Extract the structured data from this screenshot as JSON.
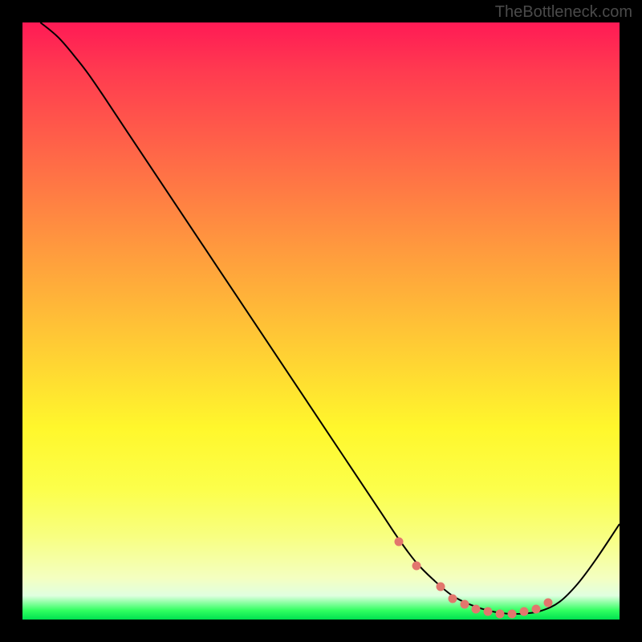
{
  "watermark": "TheBottleneck.com",
  "chart_data": {
    "type": "line",
    "title": "",
    "xlabel": "",
    "ylabel": "",
    "xlim": [
      0,
      100
    ],
    "ylim": [
      0,
      100
    ],
    "series": [
      {
        "name": "curve",
        "x": [
          3,
          6,
          9,
          12,
          18,
          24,
          30,
          36,
          42,
          48,
          54,
          60,
          63,
          66,
          69,
          72,
          75,
          78,
          81,
          84,
          87,
          90,
          93,
          96,
          100
        ],
        "y": [
          100,
          97.5,
          94,
          90,
          81,
          72,
          63,
          54,
          45,
          36,
          27,
          18,
          13.5,
          9.5,
          6.5,
          4,
          2.5,
          1.5,
          1,
          1,
          1.5,
          3,
          6,
          10,
          16
        ]
      },
      {
        "name": "highlighted-points",
        "x": [
          63,
          66,
          70,
          72,
          74,
          76,
          78,
          80,
          82,
          84,
          86,
          88
        ],
        "y": [
          13,
          9,
          5.5,
          3.5,
          2.5,
          1.8,
          1.3,
          1,
          1,
          1.3,
          1.8,
          2.8
        ]
      }
    ]
  }
}
